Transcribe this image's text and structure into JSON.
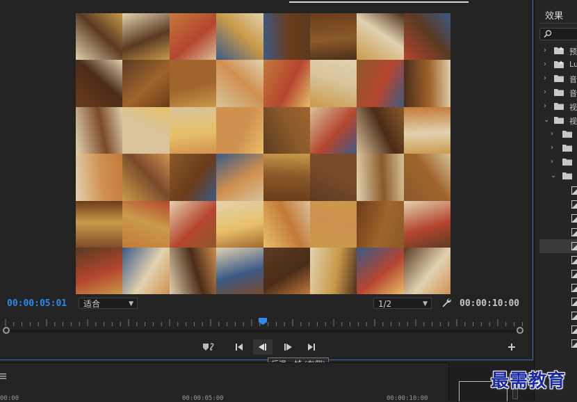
{
  "monitor": {
    "current_timecode": "00:00:05:01",
    "duration_timecode": "00:00:10:00",
    "zoom_select": "适合",
    "resolution_select": "1/2"
  },
  "transport": {
    "tooltip": "后退一帧 (左侧)"
  },
  "timeline": {
    "times": [
      "00:00",
      "00:00:05:00",
      "00:00:10:00"
    ]
  },
  "effects_panel": {
    "title": "效果",
    "items": [
      {
        "label": "预",
        "icon": "preset-folder-icon",
        "level": 0,
        "expanded": false
      },
      {
        "label": "Lu",
        "icon": "preset-folder-icon",
        "level": 0,
        "expanded": false
      },
      {
        "label": "音",
        "icon": "folder-icon",
        "level": 0,
        "expanded": false
      },
      {
        "label": "音",
        "icon": "folder-icon",
        "level": 0,
        "expanded": false
      },
      {
        "label": "视",
        "icon": "folder-icon",
        "level": 0,
        "expanded": false
      },
      {
        "label": "视",
        "icon": "folder-icon",
        "level": 0,
        "expanded": true
      }
    ]
  },
  "watermark": "最需教育",
  "colors": {
    "accent_blue": "#2d8ceb",
    "border_blue": "#3a6fb5",
    "panel_bg": "#232323"
  }
}
